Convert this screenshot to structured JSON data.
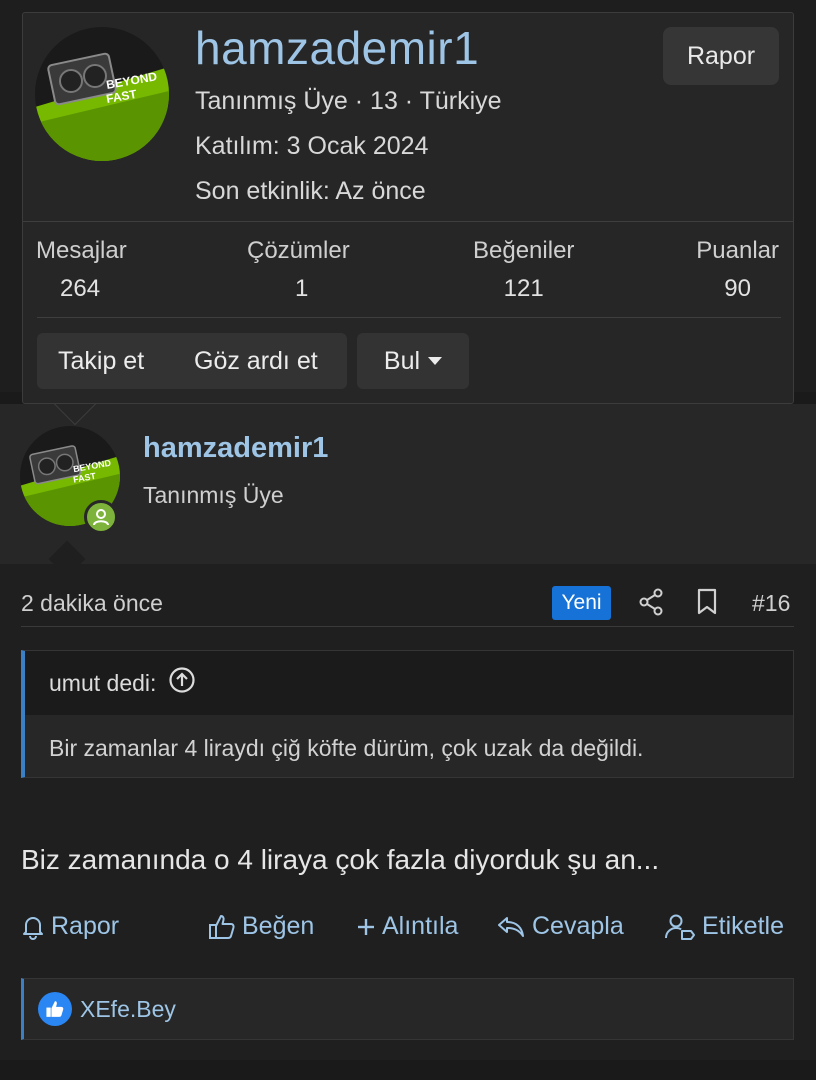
{
  "popup": {
    "username": "hamzademir1",
    "title_line": "Tanınmış Üye · 13 · Türkiye",
    "joined_line": "Katılım: 3 Ocak 2024",
    "last_activity_line": "Son etkinlik: Az önce",
    "report_label": "Rapor",
    "avatar_text_1": "BEYOND",
    "avatar_text_2": "FAST",
    "stats": [
      {
        "label": "Mesajlar",
        "value": "264"
      },
      {
        "label": "Çözümler",
        "value": "1"
      },
      {
        "label": "Beğeniler",
        "value": "121"
      },
      {
        "label": "Puanlar",
        "value": "90"
      }
    ],
    "follow_label": "Takip et",
    "ignore_label": "Göz ardı et",
    "find_label": "Bul"
  },
  "post": {
    "username": "hamzademir1",
    "role": "Tanınmış Üye",
    "time": "2 dakika önce",
    "new_badge": "Yeni",
    "post_number": "#16",
    "quote_author": "umut dedi:",
    "quote_text": "Bir zamanlar 4 liraydı çiğ köfte dürüm, çok uzak da değildi.",
    "message": "Biz zamanında o 4 liraya çok fazla diyorduk şu an...",
    "actions": {
      "report": "Rapor",
      "like": "Beğen",
      "quote": "Alıntıla",
      "reply": "Cevapla",
      "tag": "Etiketle"
    },
    "reactions": {
      "user": "XEfe.Bey"
    }
  },
  "colors": {
    "link": "#9ec5e6",
    "accent": "#1672d6",
    "online": "#7db33a",
    "like": "#2a86f3"
  }
}
